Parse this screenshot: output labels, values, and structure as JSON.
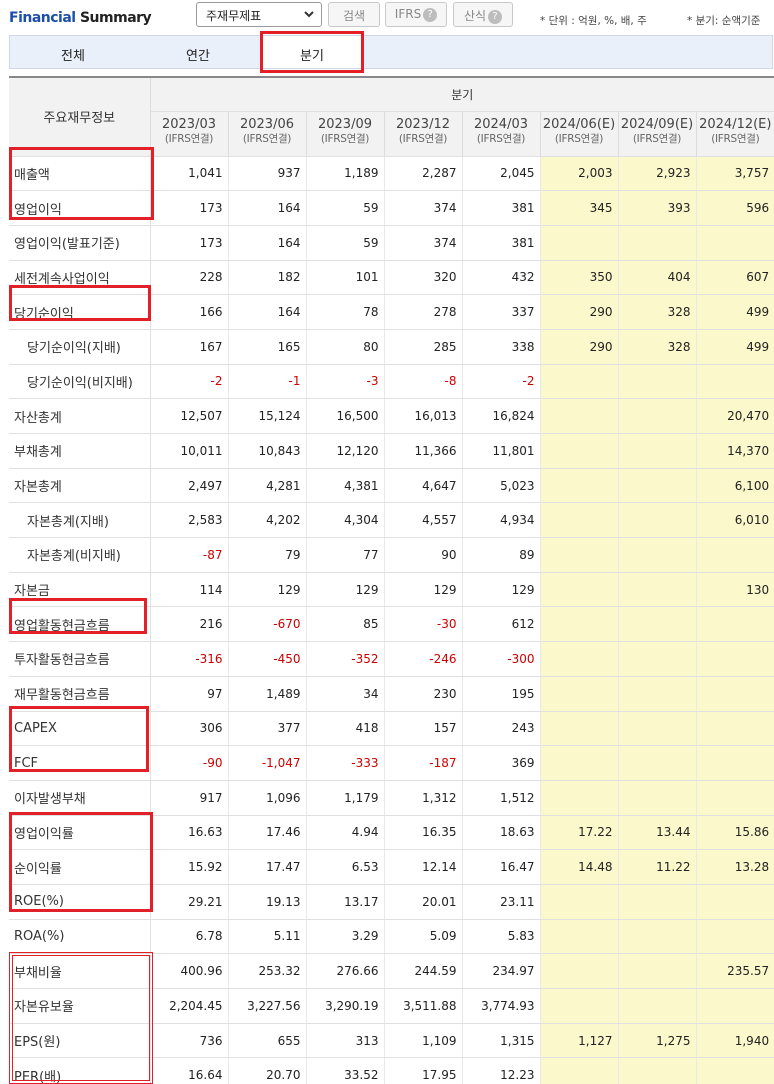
{
  "header": {
    "brand_part1": "Financial",
    "brand_part2": "Summary",
    "select_value": "주재무제표",
    "search_button": "검색",
    "ifrs_button": "IFRS",
    "formula_button": "산식",
    "help_glyph": "?",
    "unit_note": "* 단위 : 억원, %, 배, 주",
    "quarter_note": "* 분기: 순액기준"
  },
  "tabs": [
    {
      "label": "전체",
      "active": false
    },
    {
      "label": "연간",
      "active": false
    },
    {
      "label": "분기",
      "active": true
    }
  ],
  "table": {
    "label_header": "주요재무정보",
    "group_header": "분기",
    "columns": [
      {
        "period": "2023/03",
        "basis": "(IFRS연결)",
        "estimate": false
      },
      {
        "period": "2023/06",
        "basis": "(IFRS연결)",
        "estimate": false
      },
      {
        "period": "2023/09",
        "basis": "(IFRS연결)",
        "estimate": false
      },
      {
        "period": "2023/12",
        "basis": "(IFRS연결)",
        "estimate": false
      },
      {
        "period": "2024/03",
        "basis": "(IFRS연결)",
        "estimate": false
      },
      {
        "period": "2024/06(E)",
        "basis": "(IFRS연결)",
        "estimate": true
      },
      {
        "period": "2024/09(E)",
        "basis": "(IFRS연결)",
        "estimate": true
      },
      {
        "period": "2024/12(E)",
        "basis": "(IFRS연결)",
        "estimate": true
      }
    ],
    "rows": [
      {
        "label": "매출액",
        "sub": false,
        "values": [
          "1,041",
          "937",
          "1,189",
          "2,287",
          "2,045",
          "2,003",
          "2,923",
          "3,757"
        ]
      },
      {
        "label": "영업이익",
        "sub": false,
        "values": [
          "173",
          "164",
          "59",
          "374",
          "381",
          "345",
          "393",
          "596"
        ]
      },
      {
        "label": "영업이익(발표기준)",
        "sub": false,
        "values": [
          "173",
          "164",
          "59",
          "374",
          "381",
          "",
          "",
          ""
        ]
      },
      {
        "label": "세전계속사업이익",
        "sub": false,
        "values": [
          "228",
          "182",
          "101",
          "320",
          "432",
          "350",
          "404",
          "607"
        ]
      },
      {
        "label": "당기순이익",
        "sub": false,
        "values": [
          "166",
          "164",
          "78",
          "278",
          "337",
          "290",
          "328",
          "499"
        ]
      },
      {
        "label": "당기순이익(지배)",
        "sub": true,
        "values": [
          "167",
          "165",
          "80",
          "285",
          "338",
          "290",
          "328",
          "499"
        ]
      },
      {
        "label": "당기순이익(비지배)",
        "sub": true,
        "values": [
          "-2",
          "-1",
          "-3",
          "-8",
          "-2",
          "",
          "",
          ""
        ]
      },
      {
        "label": "자산총계",
        "sub": false,
        "values": [
          "12,507",
          "15,124",
          "16,500",
          "16,013",
          "16,824",
          "",
          "",
          "20,470"
        ]
      },
      {
        "label": "부채총계",
        "sub": false,
        "values": [
          "10,011",
          "10,843",
          "12,120",
          "11,366",
          "11,801",
          "",
          "",
          "14,370"
        ]
      },
      {
        "label": "자본총계",
        "sub": false,
        "values": [
          "2,497",
          "4,281",
          "4,381",
          "4,647",
          "5,023",
          "",
          "",
          "6,100"
        ]
      },
      {
        "label": "자본총계(지배)",
        "sub": true,
        "values": [
          "2,583",
          "4,202",
          "4,304",
          "4,557",
          "4,934",
          "",
          "",
          "6,010"
        ]
      },
      {
        "label": "자본총계(비지배)",
        "sub": true,
        "values": [
          "-87",
          "79",
          "77",
          "90",
          "89",
          "",
          "",
          ""
        ]
      },
      {
        "label": "자본금",
        "sub": false,
        "values": [
          "114",
          "129",
          "129",
          "129",
          "129",
          "",
          "",
          "130"
        ]
      },
      {
        "label": "영업활동현금흐름",
        "sub": false,
        "values": [
          "216",
          "-670",
          "85",
          "-30",
          "612",
          "",
          "",
          ""
        ]
      },
      {
        "label": "투자활동현금흐름",
        "sub": false,
        "values": [
          "-316",
          "-450",
          "-352",
          "-246",
          "-300",
          "",
          "",
          ""
        ]
      },
      {
        "label": "재무활동현금흐름",
        "sub": false,
        "values": [
          "97",
          "1,489",
          "34",
          "230",
          "195",
          "",
          "",
          ""
        ]
      },
      {
        "label": "CAPEX",
        "sub": false,
        "values": [
          "306",
          "377",
          "418",
          "157",
          "243",
          "",
          "",
          ""
        ]
      },
      {
        "label": "FCF",
        "sub": false,
        "values": [
          "-90",
          "-1,047",
          "-333",
          "-187",
          "369",
          "",
          "",
          ""
        ]
      },
      {
        "label": "이자발생부채",
        "sub": false,
        "values": [
          "917",
          "1,096",
          "1,179",
          "1,312",
          "1,512",
          "",
          "",
          ""
        ]
      },
      {
        "label": "영업이익률",
        "sub": false,
        "values": [
          "16.63",
          "17.46",
          "4.94",
          "16.35",
          "18.63",
          "17.22",
          "13.44",
          "15.86"
        ]
      },
      {
        "label": "순이익률",
        "sub": false,
        "values": [
          "15.92",
          "17.47",
          "6.53",
          "12.14",
          "16.47",
          "14.48",
          "11.22",
          "13.28"
        ]
      },
      {
        "label": "ROE(%)",
        "sub": false,
        "values": [
          "29.21",
          "19.13",
          "13.17",
          "20.01",
          "23.11",
          "",
          "",
          ""
        ]
      },
      {
        "label": "ROA(%)",
        "sub": false,
        "values": [
          "6.78",
          "5.11",
          "3.29",
          "5.09",
          "5.83",
          "",
          "",
          ""
        ]
      },
      {
        "label": "부채비율",
        "sub": false,
        "values": [
          "400.96",
          "253.32",
          "276.66",
          "244.59",
          "234.97",
          "",
          "",
          "235.57"
        ]
      },
      {
        "label": "자본유보율",
        "sub": false,
        "values": [
          "2,204.45",
          "3,227.56",
          "3,290.19",
          "3,511.88",
          "3,774.93",
          "",
          "",
          ""
        ]
      },
      {
        "label": "EPS(원)",
        "sub": false,
        "values": [
          "736",
          "655",
          "313",
          "1,109",
          "1,315",
          "1,127",
          "1,275",
          "1,940"
        ]
      },
      {
        "label": "PER(배)",
        "sub": false,
        "values": [
          "16.64",
          "20.70",
          "33.52",
          "17.95",
          "12.23",
          "",
          "",
          ""
        ]
      }
    ]
  },
  "colors": {
    "brand_blue": "#1e4fa8",
    "highlight_red": "#e32027",
    "negative_red": "#cc0000",
    "estimate_bg": "#fbf8cc"
  }
}
